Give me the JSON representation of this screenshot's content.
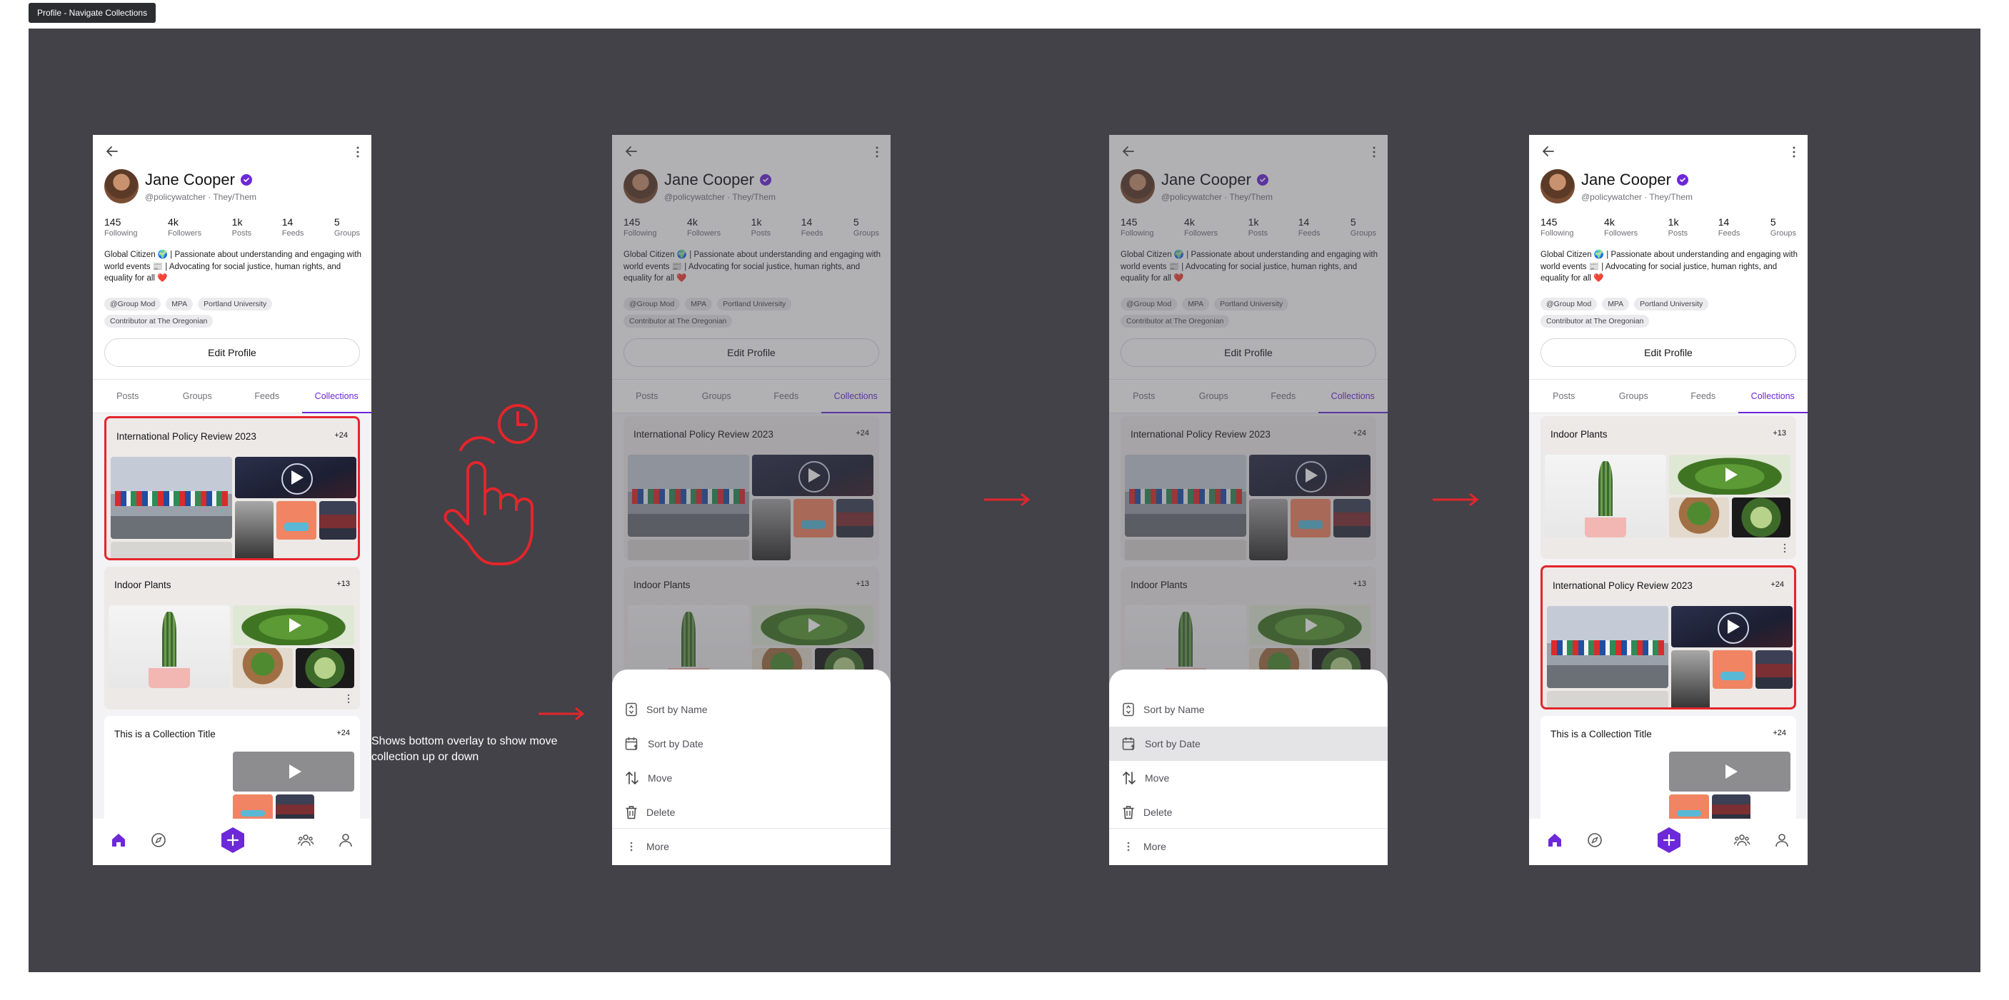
{
  "frame_label": "Profile - Navigate Collections",
  "profile": {
    "name": "Jane Cooper",
    "handle": "@policywatcher · They/Them",
    "stats": [
      {
        "value": "145",
        "label": "Following"
      },
      {
        "value": "4k",
        "label": "Followers"
      },
      {
        "value": "1k",
        "label": "Posts"
      },
      {
        "value": "14",
        "label": "Feeds"
      },
      {
        "value": "5",
        "label": "Groups"
      }
    ],
    "bio": "Global Citizen 🌍 | Passionate about understanding and engaging with world events 📰 | Advocating for social justice, human rights, and equality for all ❤️",
    "tags": [
      "@Group Mod",
      "MPA",
      "Portland University",
      "Contributor at The Oregonian"
    ],
    "edit_label": "Edit Profile"
  },
  "tabs": [
    "Posts",
    "Groups",
    "Feeds",
    "Collections"
  ],
  "collections": {
    "policy": {
      "title": "International Policy Review 2023",
      "badge": "+24"
    },
    "plants": {
      "title": "Indoor Plants",
      "badge": "+13"
    },
    "generic": {
      "title": "This is a Collection Title",
      "badge": "+24"
    }
  },
  "sheet": {
    "items": [
      "Sort by Name",
      "Sort by Date",
      "Move",
      "Delete"
    ],
    "more": "More"
  },
  "annotation": "Shows bottom overlay to  show move collection up or down",
  "colors": {
    "accent": "#6d28d9",
    "highlight": "#e4252b",
    "board": "#424248"
  }
}
